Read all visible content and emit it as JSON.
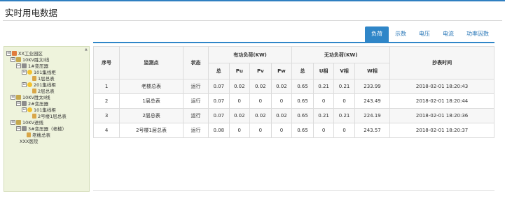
{
  "page": {
    "title": "实时用电数据"
  },
  "tabs": [
    {
      "label": "负荷",
      "active": true
    },
    {
      "label": "示数",
      "active": false
    },
    {
      "label": "电压",
      "active": false
    },
    {
      "label": "电流",
      "active": false
    },
    {
      "label": "功率因数",
      "active": false
    }
  ],
  "tree": {
    "nodes": [
      {
        "label": "XX工业园区",
        "toggle": "⊟",
        "icon": "park-icon"
      },
      {
        "label": "10KV胜太Ⅰ线",
        "toggle": "⊟",
        "icon": "line-icon"
      },
      {
        "label": "1#变压器",
        "toggle": "⊟",
        "icon": "transformer-icon"
      },
      {
        "label": "101集线柜",
        "toggle": "⊟",
        "icon": "cabinet-icon"
      },
      {
        "label": "1层总表",
        "toggle": "",
        "icon": "meter-icon"
      },
      {
        "label": "201集线柜",
        "toggle": "⊟",
        "icon": "cabinet-icon"
      },
      {
        "label": "2层总表",
        "toggle": "",
        "icon": "meter-icon"
      },
      {
        "label": "10KV胜太Ⅱ线",
        "toggle": "⊟",
        "icon": "line-icon"
      },
      {
        "label": "2#变压器",
        "toggle": "⊟",
        "icon": "transformer-icon"
      },
      {
        "label": "101集线柜",
        "toggle": "⊟",
        "icon": "cabinet-icon"
      },
      {
        "label": "2号楼1层总表",
        "toggle": "",
        "icon": "meter-icon"
      },
      {
        "label": "10KV进线",
        "toggle": "⊟",
        "icon": "line-icon"
      },
      {
        "label": "3#变压器（老楼）",
        "toggle": "⊟",
        "icon": "transformer-icon"
      },
      {
        "label": "老楼总表",
        "toggle": "",
        "icon": "meter-icon"
      },
      {
        "label": "XXX医院",
        "toggle": "",
        "icon": ""
      }
    ]
  },
  "table": {
    "headers": {
      "seq": "序号",
      "point": "监测点",
      "status": "状态",
      "active_group": "有功负荷(KW)",
      "reactive_group": "无功负荷(KW)",
      "time": "抄表时间",
      "active_cols": [
        "总",
        "Pu",
        "Pv",
        "Pw"
      ],
      "reactive_cols": [
        "总",
        "U相",
        "V相",
        "W相"
      ]
    },
    "rows": [
      {
        "seq": "1",
        "point": "老楼总表",
        "status": "运行",
        "p_total": "0.07",
        "pu": "0.02",
        "pv": "0.02",
        "pw": "0.02",
        "q_total": "0.65",
        "qu": "0.21",
        "qv": "0.21",
        "qw": "233.99",
        "time": "2018-02-01 18:20:43"
      },
      {
        "seq": "2",
        "point": "1层总表",
        "status": "运行",
        "p_total": "0.07",
        "pu": "0",
        "pv": "0",
        "pw": "0",
        "q_total": "0.65",
        "qu": "0",
        "qv": "0",
        "qw": "243.49",
        "time": "2018-02-01 18:20:44"
      },
      {
        "seq": "3",
        "point": "2层总表",
        "status": "运行",
        "p_total": "0.07",
        "pu": "0.02",
        "pv": "0.02",
        "pw": "0.02",
        "q_total": "0.65",
        "qu": "0.21",
        "qv": "0.21",
        "qw": "224.19",
        "time": "2018-02-01 18:20:36"
      },
      {
        "seq": "4",
        "point": "2号楼1层总表",
        "status": "运行",
        "p_total": "0.08",
        "pu": "0",
        "pv": "0",
        "pw": "0",
        "q_total": "0.65",
        "qu": "0",
        "qv": "0",
        "qw": "243.57",
        "time": "2018-02-01 18:20:37"
      }
    ]
  }
}
